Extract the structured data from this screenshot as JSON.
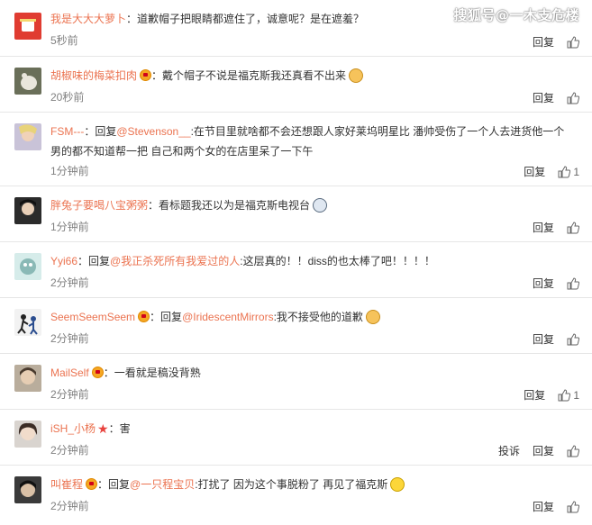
{
  "watermark": "搜狐号@一木支危楼",
  "labels": {
    "reply": "回复",
    "report": "投诉"
  },
  "comments": [
    {
      "user": "我是大大大萝卜",
      "badge": "",
      "text": "：道歉帽子把眼睛都遮住了，诚意呢？是在遮羞？",
      "time": "5秒前",
      "likes": ""
    },
    {
      "user": "胡椒味的梅菜扣肉",
      "badge": "vip",
      "text": "：戴个帽子不说是福克斯我还真看不出来",
      "emoji": "cat",
      "time": "20秒前",
      "likes": ""
    },
    {
      "user": "FSM---",
      "badge": "",
      "prefix": "：回复",
      "mention": "@Stevenson__",
      "text": ":在节目里就啥都不会还想跟人家好莱坞明星比 潘帅受伤了一个人去进货他一个男的都不知道帮一把 自己和两个女的在店里呆了一下午",
      "time": "1分钟前",
      "likes": "1"
    },
    {
      "user": "胖兔子要喝八宝粥粥",
      "badge": "",
      "text": "：看标题我还以为是福克斯电视台",
      "emoji": "tv",
      "time": "1分钟前",
      "likes": ""
    },
    {
      "user": "Yyi66",
      "badge": "",
      "prefix": "：回复",
      "mention": "@我正杀死所有我爱过的人",
      "text": ":这层真的！！diss的也太棒了吧！！！！",
      "time": "2分钟前",
      "likes": ""
    },
    {
      "user": "SeemSeemSeem",
      "badge": "vip",
      "prefix": "：回复",
      "mention": "@IridescentMirrors",
      "text": ":我不接受他的道歉",
      "emoji": "cat",
      "time": "2分钟前",
      "likes": ""
    },
    {
      "user": "MailSelf",
      "badge": "vip",
      "text": "：一看就是稿没背熟",
      "time": "2分钟前",
      "likes": "1"
    },
    {
      "user": "iSH_小杨",
      "badge": "star",
      "text": "：害",
      "time": "2分钟前",
      "likes": "",
      "report": true
    },
    {
      "user": "叫崔程",
      "badge": "vip",
      "prefix": "：回复",
      "mention": "@一只程宝贝",
      "text": ":打扰了 因为这个事脱粉了 再见了福克斯",
      "emoji": "smile",
      "time": "2分钟前",
      "likes": ""
    }
  ]
}
